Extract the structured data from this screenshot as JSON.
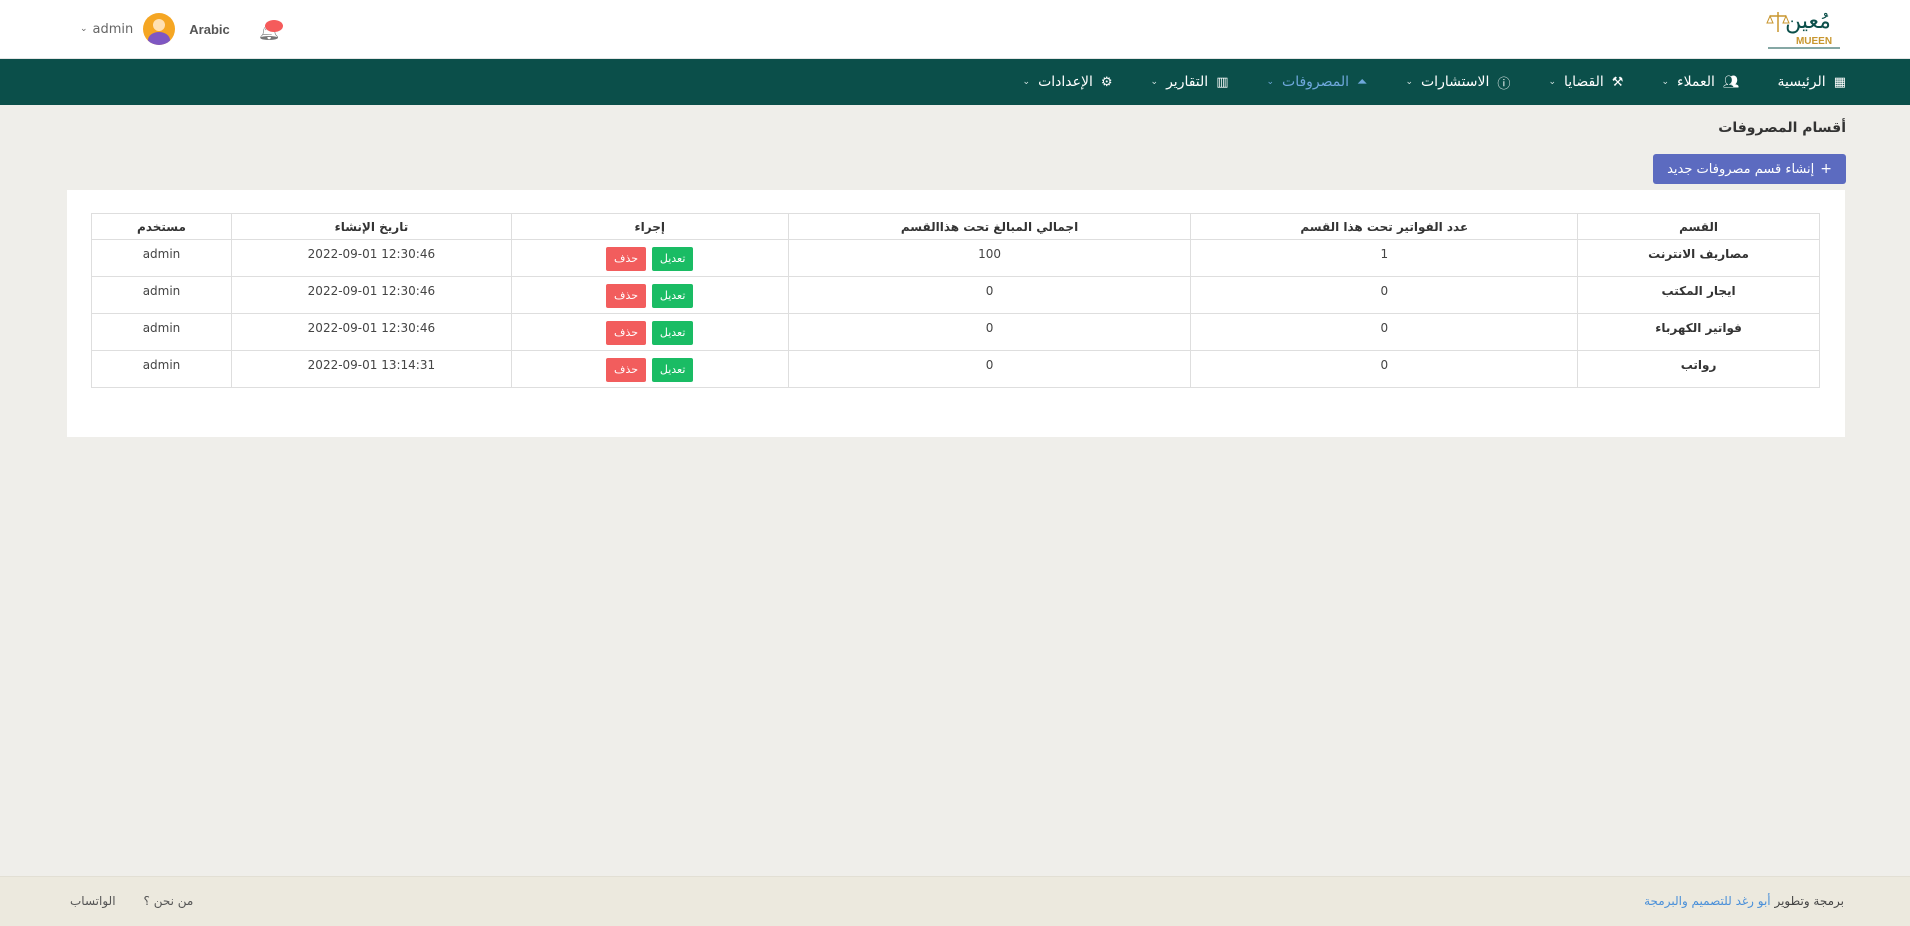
{
  "header": {
    "logo_text": "MUEEN",
    "logo_arabic": "مُعين",
    "user_name": "admin",
    "language": "Arabic"
  },
  "nav": {
    "items": [
      {
        "label": "الرئيسية",
        "icon": "dashboard-icon"
      },
      {
        "label": "العملاء",
        "icon": "users-icon"
      },
      {
        "label": "القضايا",
        "icon": "gavel-icon"
      },
      {
        "label": "الاستشارات",
        "icon": "info-icon"
      },
      {
        "label": "المصروفات",
        "icon": "chevrons-up-icon"
      },
      {
        "label": "التقارير",
        "icon": "chart-icon"
      },
      {
        "label": "الإعدادات",
        "icon": "gear-icon"
      }
    ]
  },
  "page": {
    "title": "أقسام المصروفات",
    "create_button": "إنشاء قسم مصروفات جديد"
  },
  "table": {
    "headers": [
      "القسم",
      "عدد الفواتير تحت هذا القسم",
      "اجمالي المبالغ تحت هذاالقسم",
      "إجراء",
      "تاريخ الإنشاء",
      "مستخدم"
    ],
    "edit_label": "تعديل",
    "delete_label": "حذف",
    "rows": [
      {
        "name": "مصاريف الانترنت",
        "count": "1",
        "total": "100",
        "created": "2022-09-01 12:30:46",
        "user": "admin"
      },
      {
        "name": "ايجار المكتب",
        "count": "0",
        "total": "0",
        "created": "2022-09-01 12:30:46",
        "user": "admin"
      },
      {
        "name": "فواتير الكهرباء",
        "count": "0",
        "total": "0",
        "created": "2022-09-01 12:30:46",
        "user": "admin"
      },
      {
        "name": "رواتب",
        "count": "0",
        "total": "0",
        "created": "2022-09-01 13:14:31",
        "user": "admin"
      }
    ]
  },
  "footer": {
    "credit_prefix": "برمجة وتطوير",
    "credit_link": "أبو رغد للتصميم والبرمجة",
    "about": "من نحن ؟",
    "whatsapp": "الواتساب"
  },
  "colors": {
    "navbar": "#0b4f4a",
    "primary_button": "#5c6bc0",
    "edit_button": "#1abc64",
    "delete_button": "#f25d5d",
    "active_nav": "#6fa8dc"
  }
}
